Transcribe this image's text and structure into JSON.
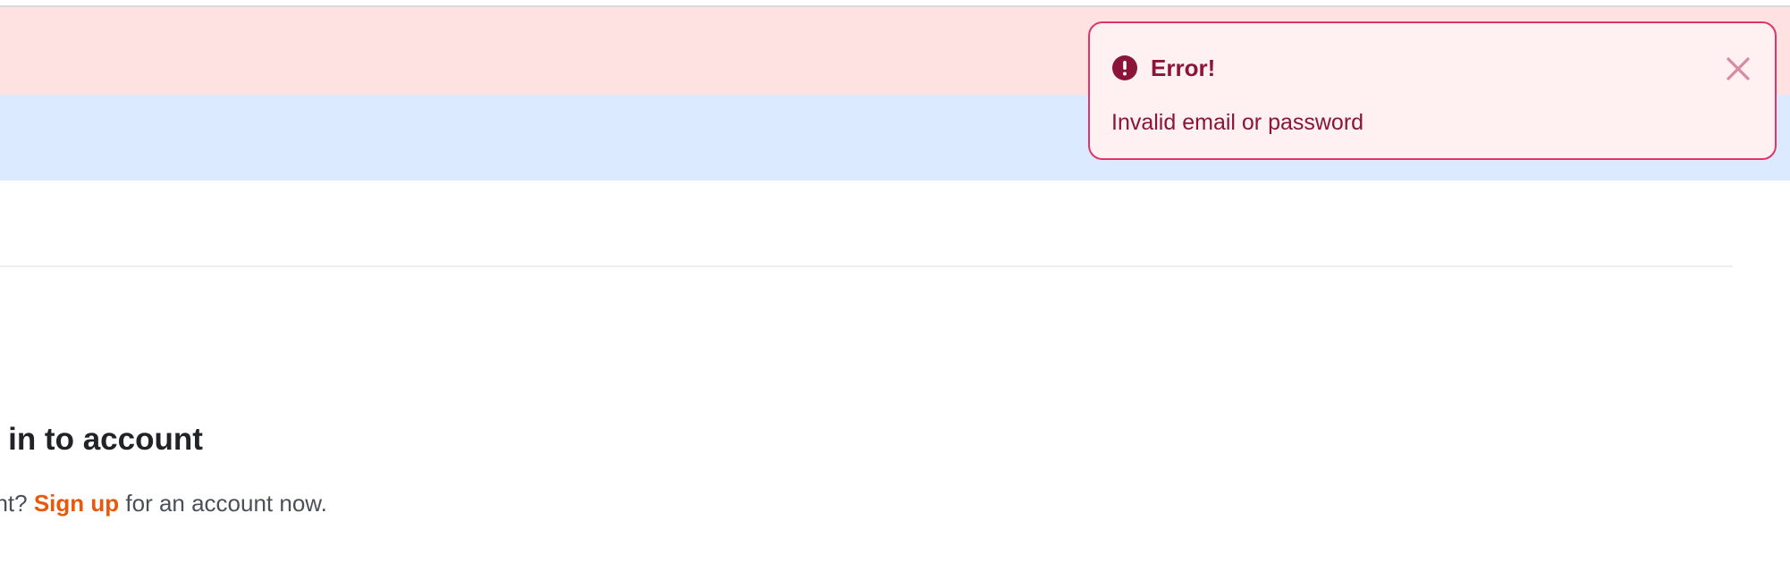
{
  "toast": {
    "title": "Error!",
    "message": "Invalid email or password",
    "icon": "exclamation-circle-icon",
    "close_icon": "close-icon",
    "colors": {
      "border": "#e2336b",
      "background": "#fff0f1",
      "text": "#8a1538"
    }
  },
  "banners": {
    "colors": [
      "#fee2e2",
      "#dbeafe"
    ]
  },
  "signin": {
    "title": "n in to account",
    "prompt_prefix": "unt? ",
    "signup_link": "Sign up",
    "prompt_suffix": " for an account now.",
    "link_color": "#ea580c"
  }
}
